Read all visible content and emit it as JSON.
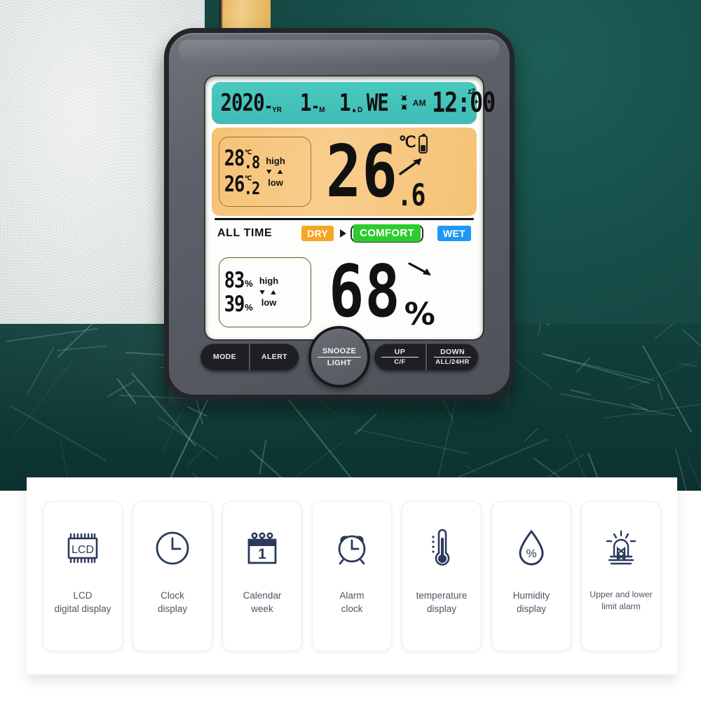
{
  "scene": {
    "background": {
      "wall_green": "#12413c",
      "wall_white": "#e2e8e6",
      "accent_gold": "#e7b963",
      "floor": "#0f3a36"
    }
  },
  "device": {
    "name": "digital-thermo-hygrometer",
    "body_color": "#5e6169",
    "display": {
      "date_bar": {
        "background": "#45c3bb",
        "year": "2020",
        "year_unit": "YR",
        "year_dash": "-",
        "month": "1",
        "month_unit": "M",
        "month_dash": "-",
        "day": "1",
        "day_unit": "D",
        "weekday": "WE",
        "alarm_icon_1": "alarm-bell",
        "alarm_icon_2": "alarm-bell",
        "meridiem": "AM",
        "snooze_indicator": "zZ",
        "time": "12:00"
      },
      "temperature": {
        "background": "#f8cd8d",
        "high_value": "28",
        "high_decimal": ".8",
        "high_unit": "℃",
        "high_label": "high",
        "low_value": "26",
        "low_decimal": ".2",
        "low_unit": "℃",
        "low_label": "low",
        "current_value": "26",
        "current_decimal": ".6",
        "current_unit": "℃",
        "trend": "up",
        "battery_icon": "battery-low"
      },
      "comfort_bar": {
        "mode_label": "ALL TIME",
        "levels": [
          {
            "label": "DRY",
            "color": "#f5a623",
            "selected": false
          },
          {
            "label": "COMFORT",
            "color": "#2dcc2d",
            "selected": true
          },
          {
            "label": "WET",
            "color": "#2196f3",
            "selected": false
          }
        ]
      },
      "humidity": {
        "background": "#96d96d",
        "high_value": "83",
        "high_unit": "%",
        "high_label": "high",
        "low_value": "39",
        "low_unit": "%",
        "low_label": "low",
        "current_value": "68",
        "current_unit": "%",
        "trend": "down"
      }
    },
    "buttons": [
      {
        "name": "mode-button",
        "top": "MODE",
        "sub": ""
      },
      {
        "name": "alert-button",
        "top": "ALERT",
        "sub": ""
      },
      {
        "name": "snooze-light-button",
        "top": "SNOOZE",
        "sub": "LIGHT"
      },
      {
        "name": "up-button",
        "top": "UP",
        "sub": "C/F"
      },
      {
        "name": "down-button",
        "top": "DOWN",
        "sub": "ALL/24HR"
      }
    ]
  },
  "features": {
    "accent_color": "#2b3a5c",
    "cards": [
      {
        "icon": "lcd-chip-icon",
        "label": "LCD\ndigital display"
      },
      {
        "icon": "clock-icon",
        "label": "Clock\ndisplay"
      },
      {
        "icon": "calendar-icon",
        "label": "Calendar\nweek"
      },
      {
        "icon": "alarm-clock-icon",
        "label": "Alarm\nclock"
      },
      {
        "icon": "thermometer-icon",
        "label": "temperature\ndisplay"
      },
      {
        "icon": "water-drop-icon",
        "label": "Humidity\ndisplay"
      },
      {
        "icon": "siren-alarm-icon",
        "label": "Upper and lower\nlimit alarm"
      }
    ]
  }
}
